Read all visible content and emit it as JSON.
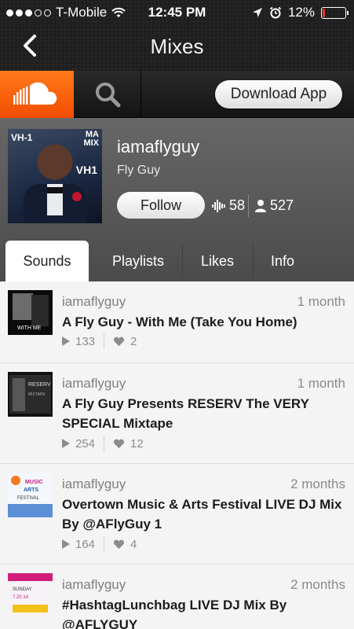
{
  "status_bar": {
    "carrier": "T-Mobile",
    "time": "12:45 PM",
    "battery": "12%",
    "battery_level": 0.12
  },
  "nav": {
    "title": "Mixes"
  },
  "toolbar": {
    "download_label": "Download App"
  },
  "profile": {
    "username": "iamaflyguy",
    "display_name": "Fly Guy",
    "follow_label": "Follow",
    "tracks_count": "58",
    "followers_count": "527"
  },
  "tabs": [
    {
      "label": "Sounds",
      "active": true
    },
    {
      "label": "Playlists"
    },
    {
      "label": "Likes"
    },
    {
      "label": "Info"
    }
  ],
  "tracks": [
    {
      "user": "iamaflyguy",
      "time": "1 month",
      "title": "A Fly Guy - With Me (Take You Home)",
      "plays": "133",
      "likes": "2"
    },
    {
      "user": "iamaflyguy",
      "time": "1 month",
      "title": "A Fly Guy Presents RESERV The VERY SPECIAL Mixtape",
      "plays": "254",
      "likes": "12"
    },
    {
      "user": "iamaflyguy",
      "time": "2 months",
      "title": "Overtown Music & Arts Festival LIVE DJ Mix By @AFlyGuy 1",
      "plays": "164",
      "likes": "4"
    },
    {
      "user": "iamaflyguy",
      "time": "2 months",
      "title": "#HashtagLunchbag LIVE DJ Mix By @AFLYGUY"
    }
  ],
  "colors": {
    "accent": "#f26a10",
    "header_bg": "#1f1f1f",
    "profile_bg": "#5a5a5a"
  },
  "icons": {
    "back": "chevron-left-icon",
    "logo": "soundcloud-logo-icon",
    "search": "search-icon",
    "tracks": "waveform-icon",
    "followers": "person-icon",
    "play": "play-icon",
    "like": "heart-icon"
  }
}
